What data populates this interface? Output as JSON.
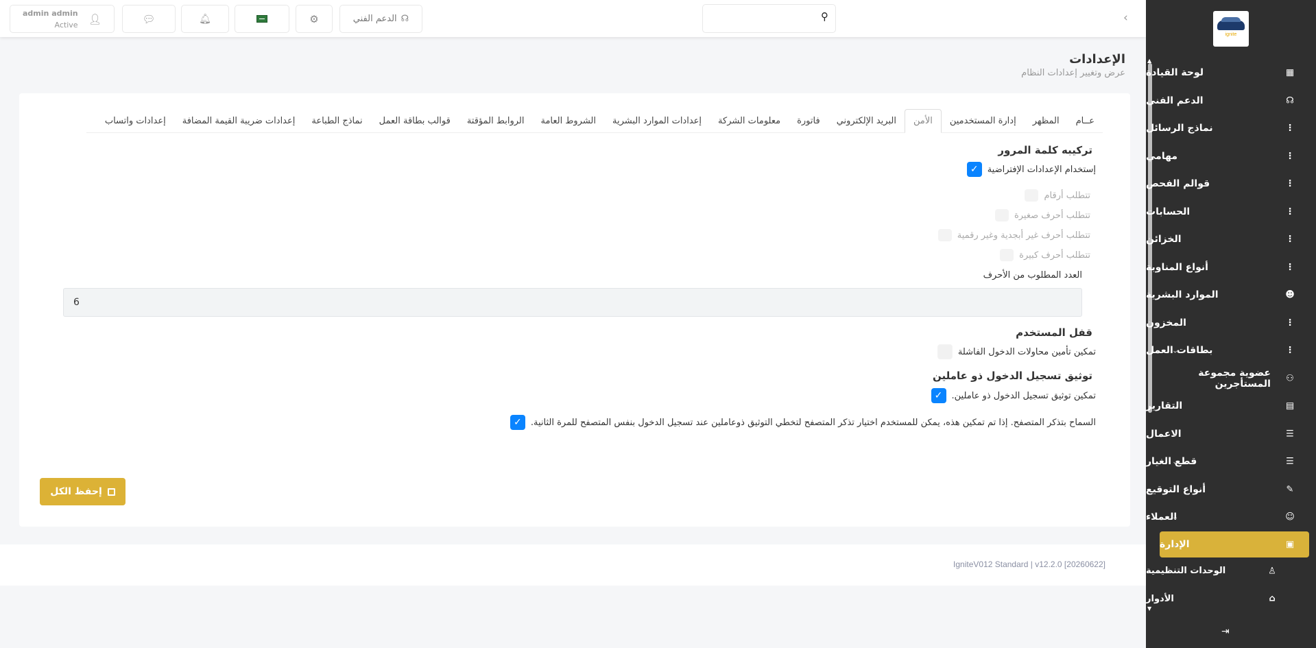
{
  "topbar": {
    "user_name": "admin admin",
    "user_status": "Active",
    "support_label": "الدعم الفني",
    "search_value": ""
  },
  "page": {
    "title": "الإعدادات",
    "subtitle": "عرض وتغيير إعدادات النظام"
  },
  "tabs": [
    {
      "label": "عــام",
      "active": false
    },
    {
      "label": "المظهر",
      "active": false
    },
    {
      "label": "إدارة المستخدمين",
      "active": false
    },
    {
      "label": "الأمن",
      "active": true
    },
    {
      "label": "البريد الإلكتروني",
      "active": false
    },
    {
      "label": "فاتورة",
      "active": false
    },
    {
      "label": "معلومات الشركة",
      "active": false
    },
    {
      "label": "إعدادات الموارد البشرية",
      "active": false
    },
    {
      "label": "الشروط العامة",
      "active": false
    },
    {
      "label": "الروابط المؤقتة",
      "active": false
    },
    {
      "label": "قوالب بطاقة العمل",
      "active": false
    },
    {
      "label": "نماذج الطباعة",
      "active": false
    },
    {
      "label": "إعدادات ضريبة القيمة المضافة",
      "active": false
    },
    {
      "label": "إعدادات واتساب",
      "active": false
    }
  ],
  "security": {
    "password_title": "تركيبه كلمة المرور",
    "use_default_label": "إستخدام الإعدادات الإفتراضية",
    "use_default_checked": true,
    "require_numbers": "تتطلب أرقام",
    "require_lowercase": "تتطلب أحرف صغيرة",
    "require_nonalnum": "تتطلب أحرف غير أبجدية وغير رقمية",
    "require_uppercase": "تتطلب أحرف كبيرة",
    "min_length_label": "العدد المطلوب من الأحرف",
    "min_length_value": "6",
    "lock_title": "قفل المستخدم",
    "lock_label": "تمكين تأمين محاولات الدخول الفاشلة",
    "lock_checked": false,
    "twofa_title": "توثيق تسجيل الدخول ذو عاملين",
    "twofa_label": "تمكين توثيق تسجيل الدخول ذو عاملين.",
    "twofa_checked": true,
    "remember_label": "السماح بتذكر المتصفح. إذا تم تمكين هذه، يمكن للمستخدم اختيار تذكر المتصفح لتخطي التوثيق ذوعاملين عند تسجيل الدخول بنفس المتصفح للمرة الثانية.",
    "remember_checked": true
  },
  "save_label": "إحفظ الكل",
  "footer": "IgniteV012 Standard | v12.2.0 [20260622]",
  "sidebar": {
    "logo_text": "ignite",
    "items": [
      {
        "label": "لوحة القيادة",
        "icon": "dashboard-icon",
        "glyph": "▦",
        "chevron": false
      },
      {
        "label": "الدعم الفني",
        "icon": "headset-icon",
        "glyph": "☊",
        "chevron": false
      },
      {
        "label": "نماذج الرسائل",
        "icon": "more-vertical-icon",
        "glyph": "⋮",
        "chevron": false
      },
      {
        "label": "مهامي",
        "icon": "more-vertical-icon",
        "glyph": "⋮",
        "chevron": false
      },
      {
        "label": "قوالم الفحص",
        "icon": "more-vertical-icon",
        "glyph": "⋮",
        "chevron": false
      },
      {
        "label": "الحسابات",
        "icon": "more-vertical-icon",
        "glyph": "⋮",
        "chevron": false
      },
      {
        "label": "الخزائن",
        "icon": "more-vertical-icon",
        "glyph": "⋮",
        "chevron": false
      },
      {
        "label": "أنواع المناوبة",
        "icon": "more-vertical-icon",
        "glyph": "⋮",
        "chevron": false
      },
      {
        "label": "الموارد البشرية",
        "icon": "users-icon",
        "glyph": "☻",
        "chevron": true
      },
      {
        "label": "المخزون",
        "icon": "more-vertical-icon",
        "glyph": "⋮",
        "chevron": false
      },
      {
        "label": "بطاقات العمل",
        "icon": "more-vertical-icon",
        "glyph": "⋮",
        "chevron": true
      },
      {
        "label": "عضوية مجموعة المستأجرين",
        "icon": "network-icon",
        "glyph": "⚇",
        "chevron": false
      },
      {
        "label": "التقارير",
        "icon": "bar-chart-icon",
        "glyph": "▤",
        "chevron": true
      },
      {
        "label": "الاعمال",
        "icon": "sliders-icon",
        "glyph": "☰",
        "chevron": true
      },
      {
        "label": "قطع الغيار",
        "icon": "sliders-icon",
        "glyph": "☰",
        "chevron": true
      },
      {
        "label": "أنواع التوقيع",
        "icon": "pen-icon",
        "glyph": "✎",
        "chevron": false
      },
      {
        "label": "العملاء",
        "icon": "user-icon",
        "glyph": "☺",
        "chevron": true
      },
      {
        "label": "الإدارة",
        "icon": "admin-icon",
        "glyph": "▣",
        "chevron": true,
        "active": true
      },
      {
        "label": "الوحدات التنظيمية",
        "icon": "org-chart-icon",
        "glyph": "♙",
        "chevron": false,
        "sub": true
      },
      {
        "label": "الأدوار",
        "icon": "briefcase-icon",
        "glyph": "⌂",
        "chevron": false,
        "sub": true
      }
    ]
  }
}
